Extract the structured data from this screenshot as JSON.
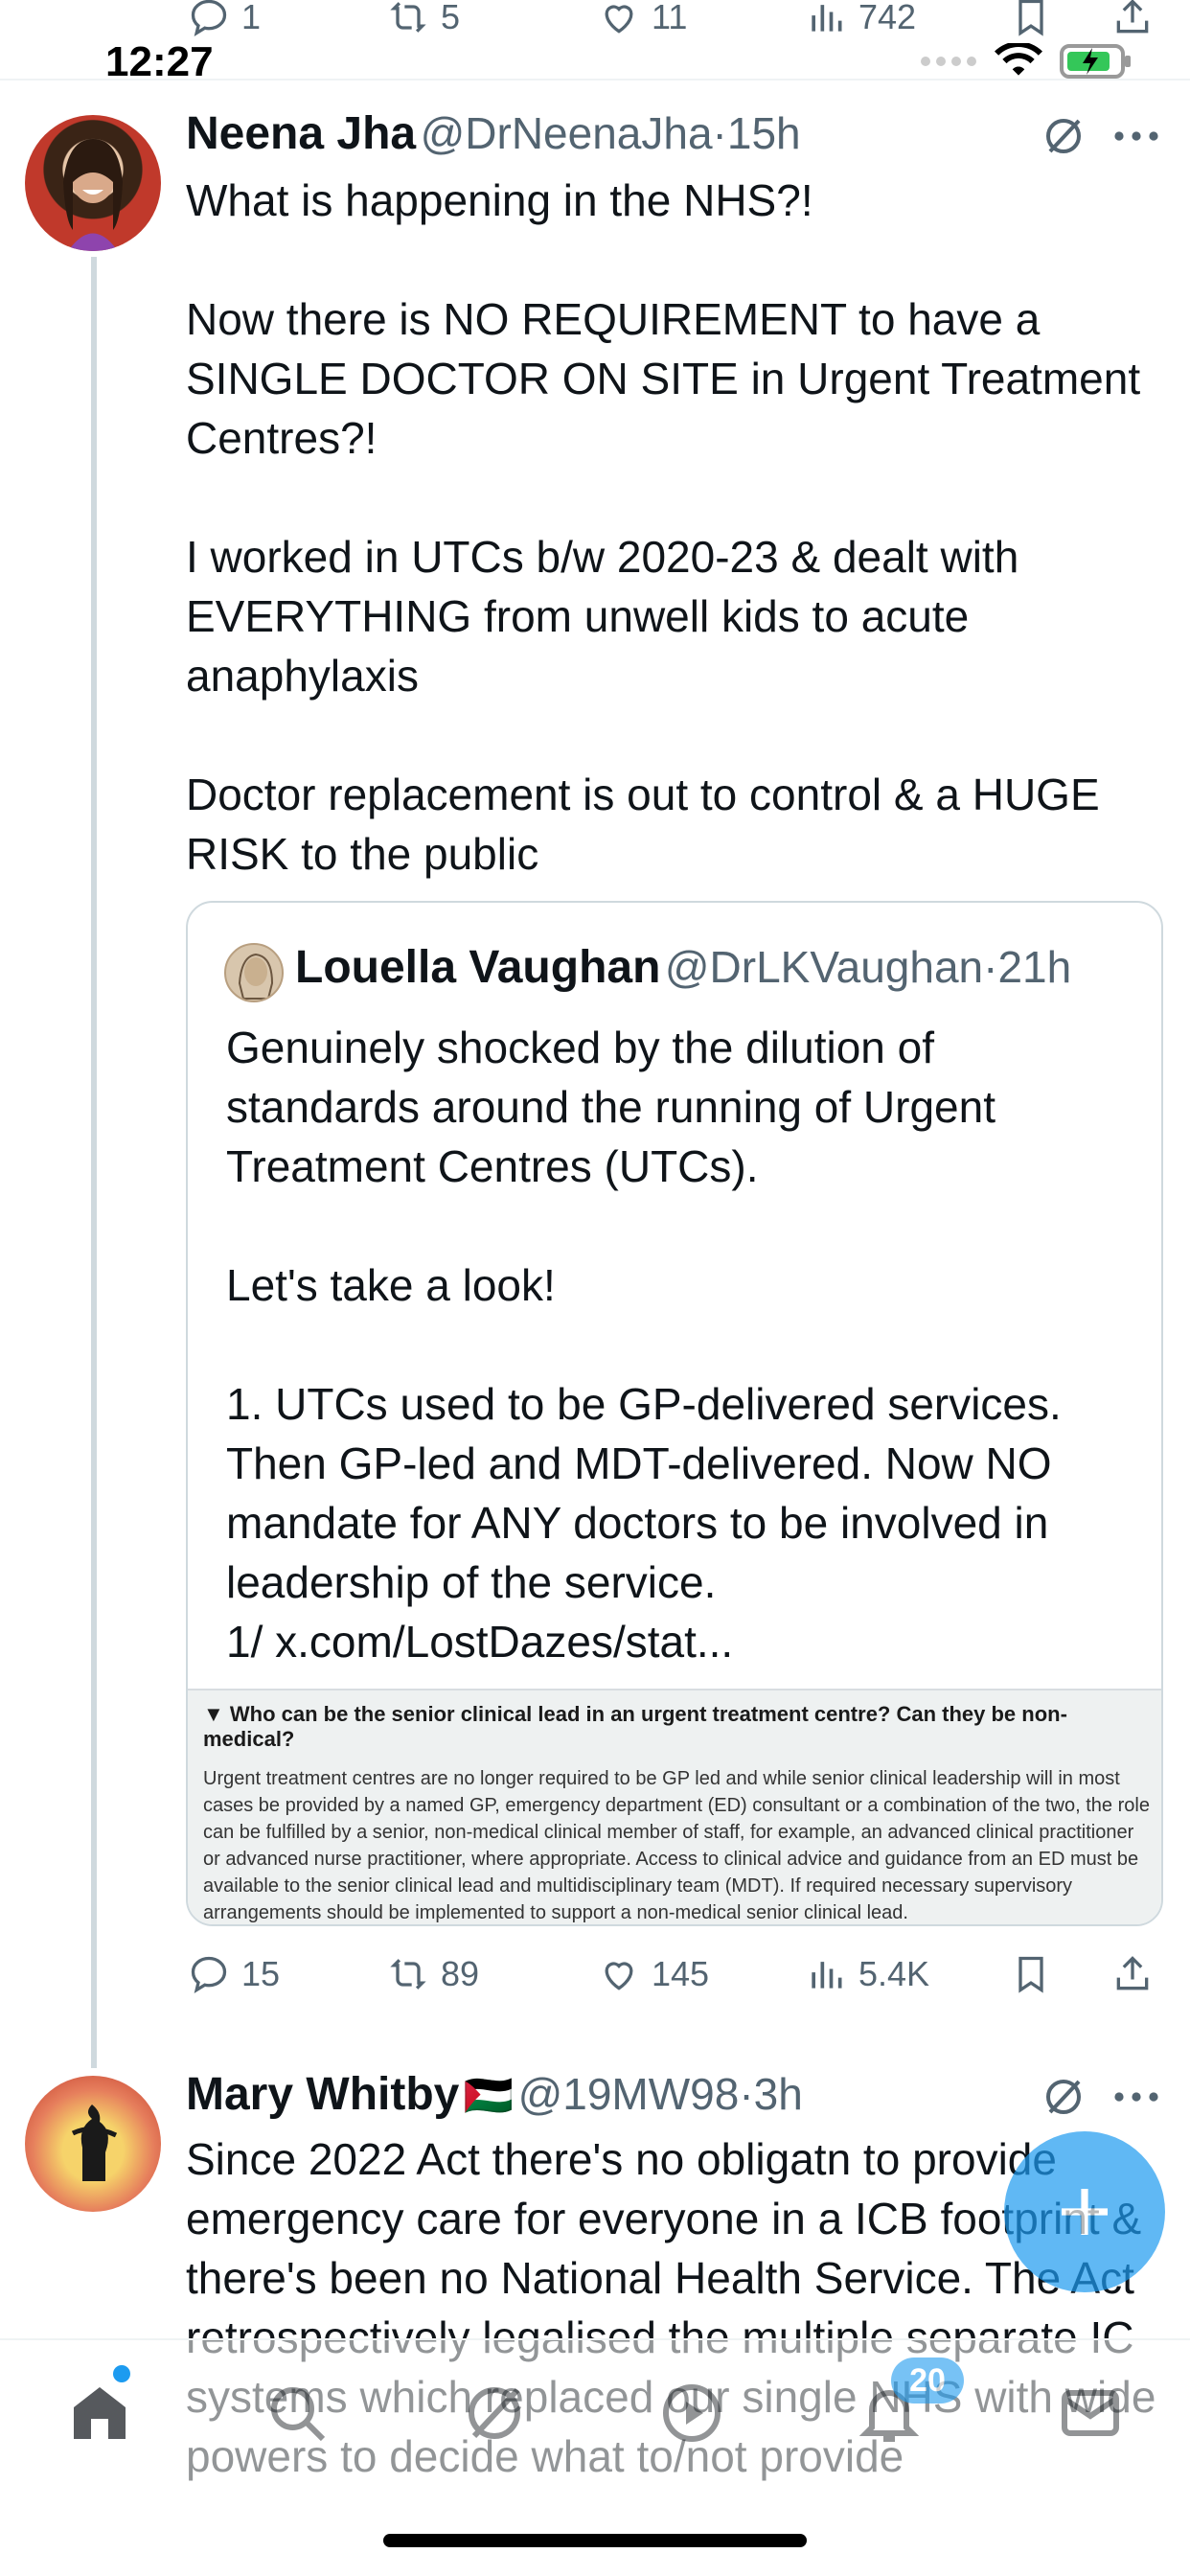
{
  "status_bar": {
    "time": "12:27"
  },
  "prev_tweet_actions": {
    "replies": "1",
    "reposts": "5",
    "likes": "11",
    "views": "742"
  },
  "tweet": {
    "author_name": "Neena Jha",
    "author_handle": "@DrNeenaJha",
    "sep": "·",
    "time_ago": "15h",
    "text": "What is happening in the NHS?!\n\nNow there is NO REQUIREMENT to have a SINGLE DOCTOR ON SITE in Urgent Treatment Centres?!\n\nI worked in UTCs b/w 2020-23 & dealt with EVERYTHING from unwell kids to acute anaphylaxis\n\nDoctor replacement is out to control & a HUGE RISK to the public",
    "quote": {
      "author_name": "Louella Vaughan",
      "author_handle": "@DrLKVaughan",
      "sep": "·",
      "time_ago": "21h",
      "text": "Genuinely shocked by the dilution of standards around the running of Urgent Treatment Centres (UTCs).\n\nLet's take a look!\n\n1. UTCs used to be GP-delivered services. Then GP-led and MDT-delivered. Now NO mandate for ANY doctors to be involved in leadership of the service.\n1/ x.com/LostDazes/stat...",
      "image_question": "▼  Who can be the senior clinical lead in an urgent treatment centre? Can they be non-medical?",
      "image_answer": "Urgent treatment centres are no longer required to be GP led and while senior clinical leadership will in most cases be provided by a named GP, emergency department (ED) consultant or a combination of the two, the role can be fulfilled by a senior, non-medical clinical member of staff, for example, an advanced clinical practitioner or advanced nurse practitioner, where appropriate. Access to clinical advice and guidance from an ED must be available to the senior clinical lead and multidisciplinary team (MDT). If required necessary supervisory arrangements should be implemented to support a non-medical senior clinical lead."
    },
    "actions": {
      "replies": "15",
      "reposts": "89",
      "likes": "145",
      "views": "5.4K"
    }
  },
  "reply": {
    "author_name": "Mary Whitby",
    "flag": "🇵🇸",
    "author_handle": "@19MW98",
    "sep": "·",
    "time_ago": "3h",
    "text": "Since 2022 Act there's no obligatn to provide emergency care for everyone in a ICB footprint & there's been no National Health Service. The Act retrospectively legalised the multiple separate IC systems which replaced our single NHS with wide powers to decide what to/not provide"
  },
  "nav": {
    "notifications_badge": "20"
  },
  "colors": {
    "accent": "#1d9bf0",
    "text": "#0f1419",
    "muted": "#536471",
    "border": "#cfd9de"
  },
  "icons": [
    "reply-icon",
    "repost-icon",
    "like-icon",
    "views-icon",
    "bookmark-icon",
    "share-icon",
    "grok-icon",
    "more-icon",
    "home-icon",
    "search-icon",
    "communities-icon",
    "spaces-icon",
    "notifications-icon",
    "messages-icon",
    "compose-icon"
  ]
}
